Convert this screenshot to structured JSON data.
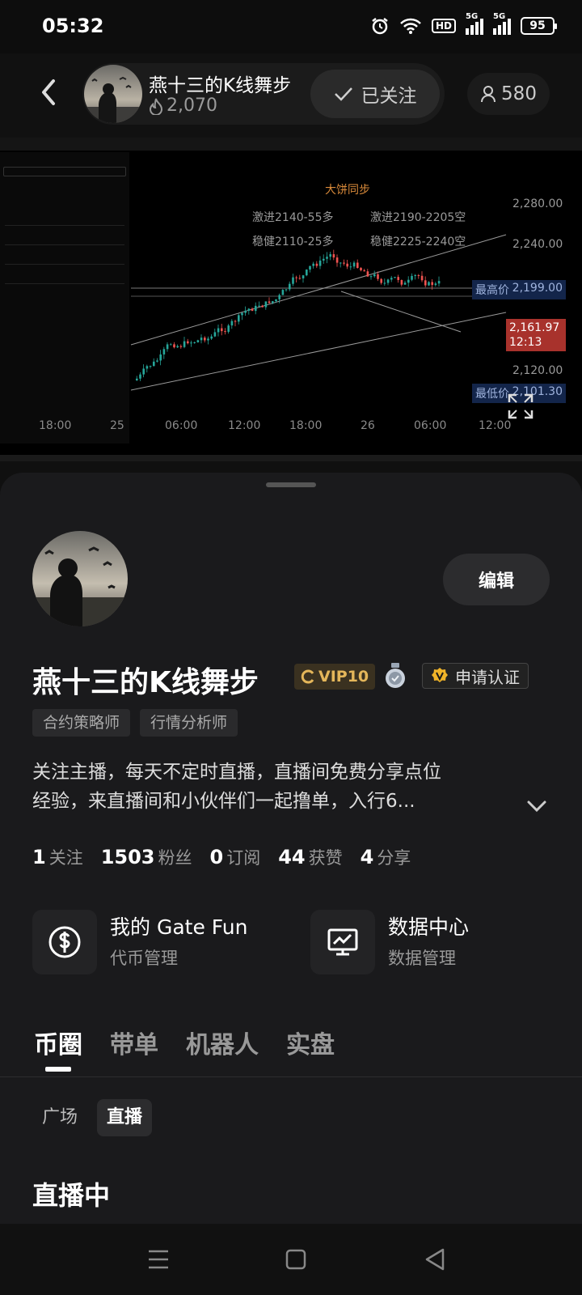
{
  "status_bar": {
    "time": "05:32",
    "hd": "HD",
    "net1": "5G",
    "net2": "5G",
    "battery": "95"
  },
  "live_header": {
    "streamer_name": "燕十三的K线舞步",
    "heat": "2,070",
    "follow_label": "已关注",
    "viewers": "580"
  },
  "stream_chart": {
    "title": "大饼同步",
    "notes": [
      "激进2140-55多",
      "稳健2110-25多",
      "激进2190-2205空",
      "稳健2225-2240空"
    ],
    "price_axis": [
      "2,280.00",
      "2,240.00",
      "2,120.00"
    ],
    "high_label": "最高价",
    "high_value": "2,199.00",
    "current_value": "2,161.97",
    "current_time": "12:13",
    "low_label": "最低价",
    "low_value": "2,101.30",
    "time_axis": [
      "18:00",
      "25",
      "06:00",
      "12:00",
      "18:00",
      "26",
      "06:00",
      "12:00"
    ]
  },
  "profile": {
    "name": "燕十三的K线舞步",
    "vip": "VIP10",
    "verify_label": "申请认证",
    "edit_label": "编辑",
    "tags": [
      "合约策略师",
      "行情分析师"
    ],
    "bio_line1": "关注主播，每天不定时直播，直播间免费分享点位",
    "bio_line2": "经验，来直播间和小伙伴们一起撸单，入行6..."
  },
  "stats": [
    {
      "value": "1",
      "label": "关注"
    },
    {
      "value": "1503",
      "label": "粉丝"
    },
    {
      "value": "0",
      "label": "订阅"
    },
    {
      "value": "44",
      "label": "获赞"
    },
    {
      "value": "4",
      "label": "分享"
    }
  ],
  "features": [
    {
      "title": "我的 Gate Fun",
      "subtitle": "代币管理",
      "icon": "dollar-circle-icon"
    },
    {
      "title": "数据中心",
      "subtitle": "数据管理",
      "icon": "monitor-chart-icon"
    }
  ],
  "tabs": [
    "币圈",
    "带单",
    "机器人",
    "实盘"
  ],
  "subtabs": [
    "广场",
    "直播"
  ],
  "section_title": "直播中",
  "colors": {
    "background": "#1a1a1c",
    "vip_gold": "#e4b65a",
    "price_red": "#c0392b",
    "price_blue": "#1e3a6e"
  }
}
